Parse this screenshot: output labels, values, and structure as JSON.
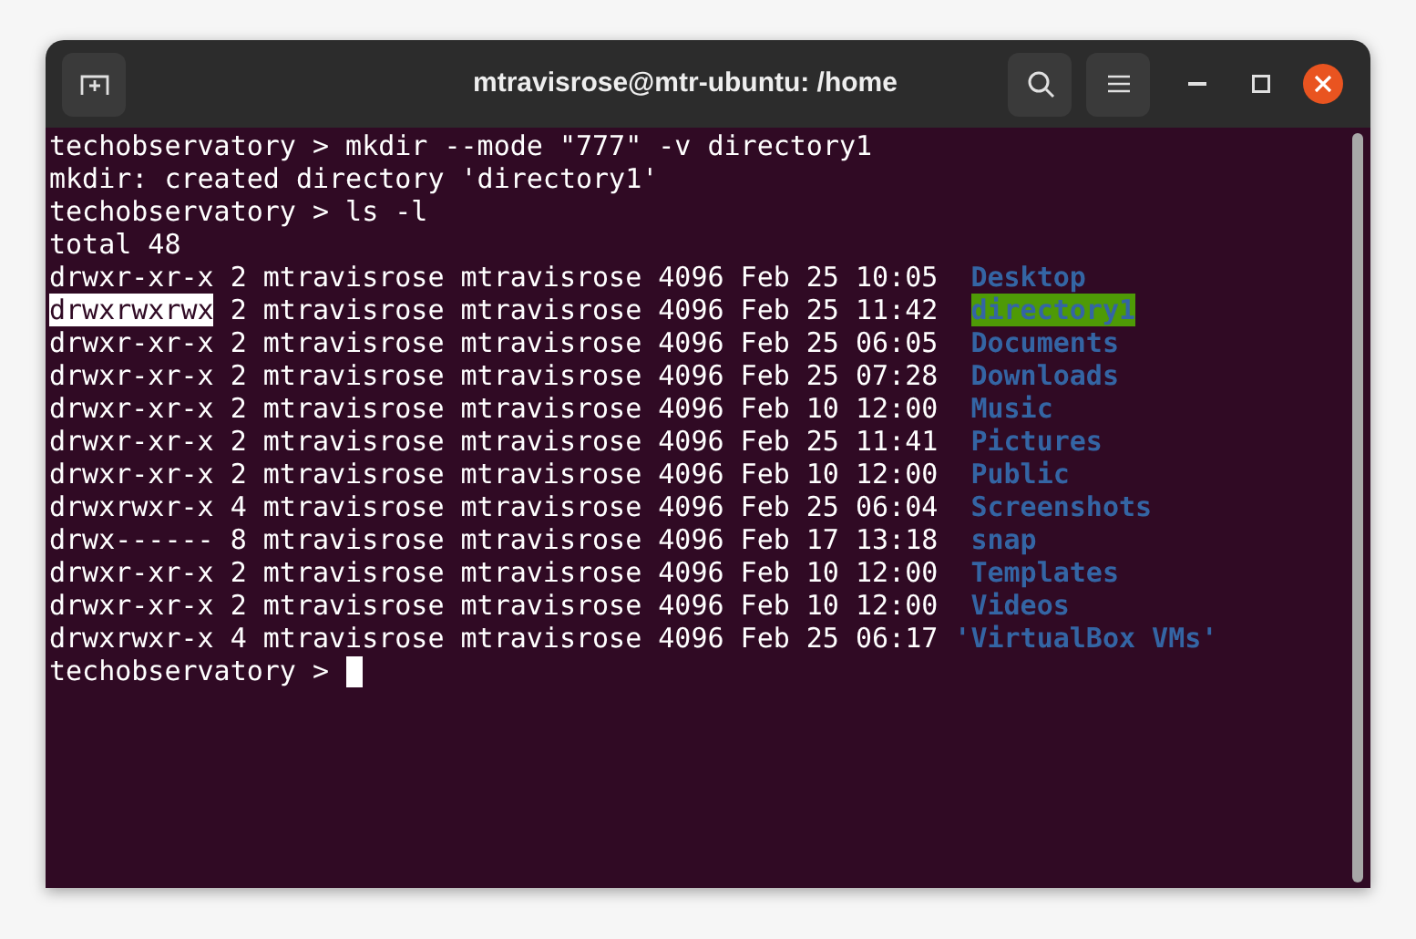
{
  "window": {
    "title": "mtravisrose@mtr-ubuntu: /home"
  },
  "terminal": {
    "lines": [
      {
        "kind": "text",
        "text": "techobservatory > mkdir --mode \"777\" -v directory1"
      },
      {
        "kind": "text",
        "text": "mkdir: created directory 'directory1'"
      },
      {
        "kind": "text",
        "text": "techobservatory > ls -l"
      },
      {
        "kind": "text",
        "text": "total 48"
      },
      {
        "kind": "entry",
        "permissions": "drwxr-xr-x",
        "permissions_highlighted": false,
        "details": "2 mtravisrose mtravisrose 4096 Feb 25 10:05",
        "name": "Desktop",
        "quoted": false,
        "name_highlighted": false
      },
      {
        "kind": "entry",
        "permissions": "drwxrwxrwx",
        "permissions_highlighted": true,
        "details": "2 mtravisrose mtravisrose 4096 Feb 25 11:42",
        "name": "directory1",
        "quoted": false,
        "name_highlighted": true
      },
      {
        "kind": "entry",
        "permissions": "drwxr-xr-x",
        "permissions_highlighted": false,
        "details": "2 mtravisrose mtravisrose 4096 Feb 25 06:05",
        "name": "Documents",
        "quoted": false,
        "name_highlighted": false
      },
      {
        "kind": "entry",
        "permissions": "drwxr-xr-x",
        "permissions_highlighted": false,
        "details": "2 mtravisrose mtravisrose 4096 Feb 25 07:28",
        "name": "Downloads",
        "quoted": false,
        "name_highlighted": false
      },
      {
        "kind": "entry",
        "permissions": "drwxr-xr-x",
        "permissions_highlighted": false,
        "details": "2 mtravisrose mtravisrose 4096 Feb 10 12:00",
        "name": "Music",
        "quoted": false,
        "name_highlighted": false
      },
      {
        "kind": "entry",
        "permissions": "drwxr-xr-x",
        "permissions_highlighted": false,
        "details": "2 mtravisrose mtravisrose 4096 Feb 25 11:41",
        "name": "Pictures",
        "quoted": false,
        "name_highlighted": false
      },
      {
        "kind": "entry",
        "permissions": "drwxr-xr-x",
        "permissions_highlighted": false,
        "details": "2 mtravisrose mtravisrose 4096 Feb 10 12:00",
        "name": "Public",
        "quoted": false,
        "name_highlighted": false
      },
      {
        "kind": "entry",
        "permissions": "drwxrwxr-x",
        "permissions_highlighted": false,
        "details": "4 mtravisrose mtravisrose 4096 Feb 25 06:04",
        "name": "Screenshots",
        "quoted": false,
        "name_highlighted": false
      },
      {
        "kind": "entry",
        "permissions": "drwx------",
        "permissions_highlighted": false,
        "details": "8 mtravisrose mtravisrose 4096 Feb 17 13:18",
        "name": "snap",
        "quoted": false,
        "name_highlighted": false
      },
      {
        "kind": "entry",
        "permissions": "drwxr-xr-x",
        "permissions_highlighted": false,
        "details": "2 mtravisrose mtravisrose 4096 Feb 10 12:00",
        "name": "Templates",
        "quoted": false,
        "name_highlighted": false
      },
      {
        "kind": "entry",
        "permissions": "drwxr-xr-x",
        "permissions_highlighted": false,
        "details": "2 mtravisrose mtravisrose 4096 Feb 10 12:00",
        "name": "Videos",
        "quoted": false,
        "name_highlighted": false
      },
      {
        "kind": "entry",
        "permissions": "drwxrwxr-x",
        "permissions_highlighted": false,
        "details": "4 mtravisrose mtravisrose 4096 Feb 25 06:17",
        "name": "'VirtualBox VMs'",
        "quoted": true,
        "name_highlighted": false
      },
      {
        "kind": "prompt",
        "text": "techobservatory >",
        "cursor": true
      }
    ]
  }
}
